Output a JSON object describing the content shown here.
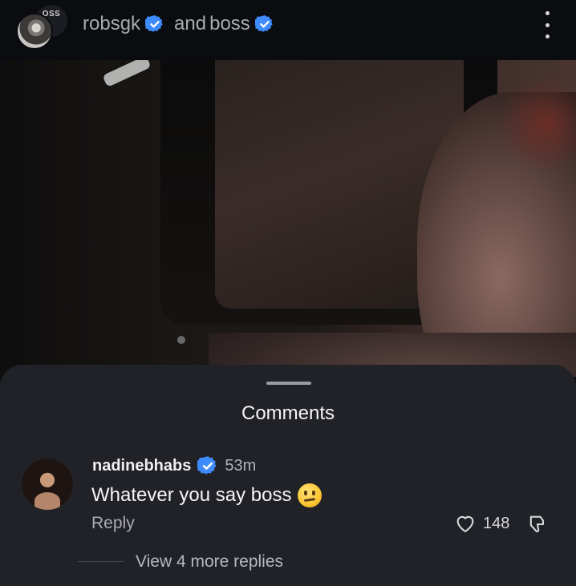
{
  "header": {
    "avatar_back_text": "OSS",
    "owners": [
      "robsgk",
      "boss"
    ],
    "joiner": "and",
    "menu_icon": "more-vert-icon"
  },
  "video": {
    "description_visible": false
  },
  "comments": {
    "title": "Comments",
    "items": [
      {
        "username": "nadinebhabs",
        "verified": true,
        "time": "53m",
        "text": "Whatever you say boss",
        "emoji": "saluting-face",
        "reply_label": "Reply",
        "likes": "148",
        "view_more": "View 4 more replies"
      }
    ]
  },
  "colors": {
    "verified_blue": "#3d8bfd",
    "sheet_bg": "#212227",
    "header_bg": "#0b0c10"
  }
}
